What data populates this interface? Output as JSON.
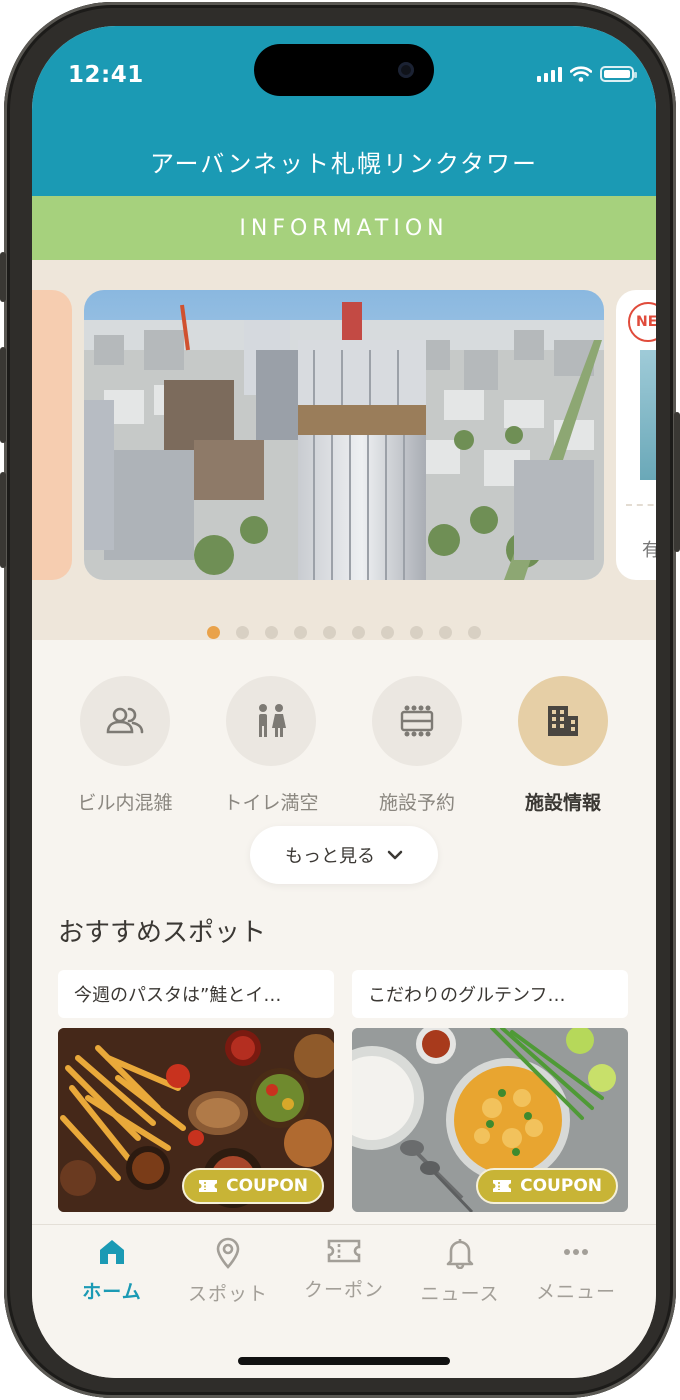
{
  "status_bar": {
    "time": "12:41"
  },
  "header": {
    "title": "アーバンネット札幌リンクタワー"
  },
  "info_bar": {
    "label": "INFORMATION"
  },
  "carousel": {
    "right_card_badge": "NE",
    "right_card_text": "有",
    "active_index": 0,
    "dot_count": 10
  },
  "quick_menu": [
    {
      "label": "ビル内混雑",
      "icon": "people-icon",
      "active": false
    },
    {
      "label": "トイレ満空",
      "icon": "restroom-icon",
      "active": false
    },
    {
      "label": "施設予約",
      "icon": "facility-reservation-icon",
      "active": false
    },
    {
      "label": "施設情報",
      "icon": "building-icon",
      "active": true
    }
  ],
  "more_button": {
    "label": "もっと見る"
  },
  "recommended": {
    "title": "おすすめスポット",
    "items": [
      {
        "caption": "今週のパスタは”鮭とイ…",
        "badge": "COUPON"
      },
      {
        "caption": "こだわりのグルテンフ…",
        "badge": "COUPON"
      }
    ]
  },
  "tab_bar": [
    {
      "label": "ホーム",
      "icon": "home-icon",
      "active": true
    },
    {
      "label": "スポット",
      "icon": "location-pin-icon",
      "active": false
    },
    {
      "label": "クーポン",
      "icon": "ticket-icon",
      "active": false
    },
    {
      "label": "ニュース",
      "icon": "bell-icon",
      "active": false
    },
    {
      "label": "メニュー",
      "icon": "more-dots-icon",
      "active": false
    }
  ],
  "colors": {
    "primary": "#1b9ab4",
    "info_bar": "#a6d17d",
    "active_dot": "#e9a24a",
    "coupon": "#c8b436"
  }
}
